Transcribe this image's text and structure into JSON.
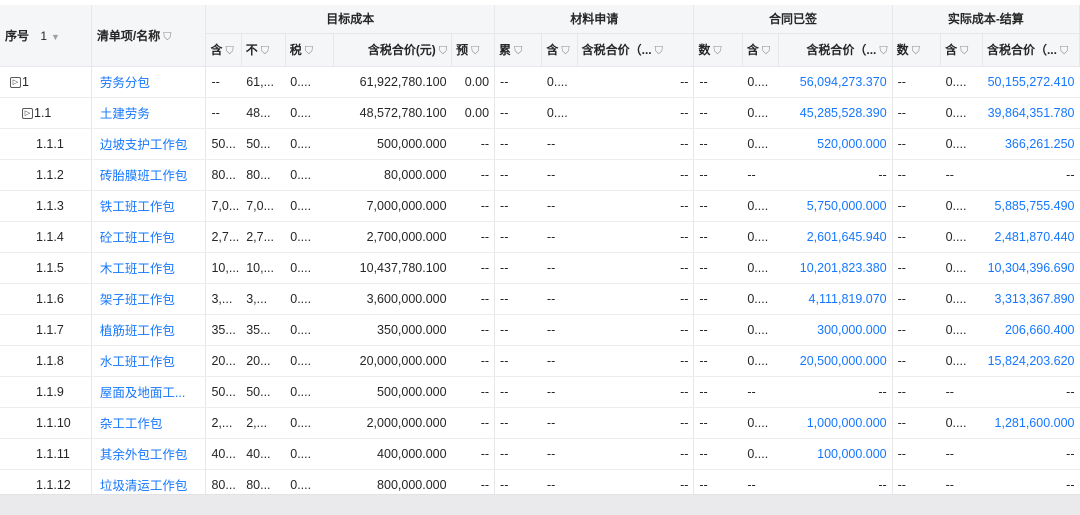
{
  "header": {
    "seq_label": "序号",
    "page_value": "1",
    "name_label": "清单项/名称",
    "groups": [
      "目标成本",
      "材料申请",
      "合同已签",
      "实际成本-结算"
    ],
    "subcols": [
      "含",
      "不",
      "税",
      "含税合价(元)",
      "预",
      "累",
      "含",
      "含税合价（...",
      "数",
      "含",
      "含税合价（...",
      "数",
      "含",
      "含税合价（..."
    ]
  },
  "rows": [
    {
      "seq": "1",
      "expand": true,
      "name": "劳务分包",
      "cells": [
        "--",
        "61,...",
        "0....",
        "61,922,780.100",
        "0.00",
        "--",
        "0....",
        "--",
        "--",
        "0....",
        "56,094,273.370",
        "--",
        "0....",
        "50,155,272.410"
      ]
    },
    {
      "seq": "1.1",
      "expand": true,
      "name": "土建劳务",
      "cells": [
        "--",
        "48...",
        "0....",
        "48,572,780.100",
        "0.00",
        "--",
        "0....",
        "--",
        "--",
        "0....",
        "45,285,528.390",
        "--",
        "0....",
        "39,864,351.780"
      ]
    },
    {
      "seq": "1.1.1",
      "name": "边坡支护工作包",
      "cells": [
        "50...",
        "50...",
        "0....",
        "500,000.000",
        "--",
        "--",
        "--",
        "--",
        "--",
        "0....",
        "520,000.000",
        "--",
        "0....",
        "366,261.250"
      ]
    },
    {
      "seq": "1.1.2",
      "name": "砖胎膜班工作包",
      "cells": [
        "80...",
        "80...",
        "0....",
        "80,000.000",
        "--",
        "--",
        "--",
        "--",
        "--",
        "--",
        "--",
        "--",
        "--",
        "--"
      ]
    },
    {
      "seq": "1.1.3",
      "name": "铁工班工作包",
      "cells": [
        "7,0...",
        "7,0...",
        "0....",
        "7,000,000.000",
        "--",
        "--",
        "--",
        "--",
        "--",
        "0....",
        "5,750,000.000",
        "--",
        "0....",
        "5,885,755.490"
      ]
    },
    {
      "seq": "1.1.4",
      "name": "砼工班工作包",
      "cells": [
        "2,7...",
        "2,7...",
        "0....",
        "2,700,000.000",
        "--",
        "--",
        "--",
        "--",
        "--",
        "0....",
        "2,601,645.940",
        "--",
        "0....",
        "2,481,870.440"
      ]
    },
    {
      "seq": "1.1.5",
      "name": "木工班工作包",
      "cells": [
        "10,...",
        "10,...",
        "0....",
        "10,437,780.100",
        "--",
        "--",
        "--",
        "--",
        "--",
        "0....",
        "10,201,823.380",
        "--",
        "0....",
        "10,304,396.690"
      ]
    },
    {
      "seq": "1.1.6",
      "name": "架子班工作包",
      "cells": [
        "3,...",
        "3,...",
        "0....",
        "3,600,000.000",
        "--",
        "--",
        "--",
        "--",
        "--",
        "0....",
        "4,111,819.070",
        "--",
        "0....",
        "3,313,367.890"
      ]
    },
    {
      "seq": "1.1.7",
      "name": "植筋班工作包",
      "cells": [
        "35...",
        "35...",
        "0....",
        "350,000.000",
        "--",
        "--",
        "--",
        "--",
        "--",
        "0....",
        "300,000.000",
        "--",
        "0....",
        "206,660.400"
      ]
    },
    {
      "seq": "1.1.8",
      "name": "水工班工作包",
      "cells": [
        "20...",
        "20...",
        "0....",
        "20,000,000.000",
        "--",
        "--",
        "--",
        "--",
        "--",
        "0....",
        "20,500,000.000",
        "--",
        "0....",
        "15,824,203.620"
      ]
    },
    {
      "seq": "1.1.9",
      "name": "屋面及地面工...",
      "cells": [
        "50...",
        "50...",
        "0....",
        "500,000.000",
        "--",
        "--",
        "--",
        "--",
        "--",
        "--",
        "--",
        "--",
        "--",
        "--"
      ]
    },
    {
      "seq": "1.1.10",
      "name": "杂工工作包",
      "cells": [
        "2,...",
        "2,...",
        "0....",
        "2,000,000.000",
        "--",
        "--",
        "--",
        "--",
        "--",
        "0....",
        "1,000,000.000",
        "--",
        "0....",
        "1,281,600.000"
      ]
    },
    {
      "seq": "1.1.11",
      "name": "其余外包工作包",
      "cells": [
        "40...",
        "40...",
        "0....",
        "400,000.000",
        "--",
        "--",
        "--",
        "--",
        "--",
        "0....",
        "100,000.000",
        "--",
        "--",
        "--"
      ]
    },
    {
      "seq": "1.1.12",
      "name": "垃圾清运工作包",
      "cells": [
        "80...",
        "80...",
        "0....",
        "800,000.000",
        "--",
        "--",
        "--",
        "--",
        "--",
        "--",
        "--",
        "--",
        "--",
        "--"
      ]
    }
  ]
}
